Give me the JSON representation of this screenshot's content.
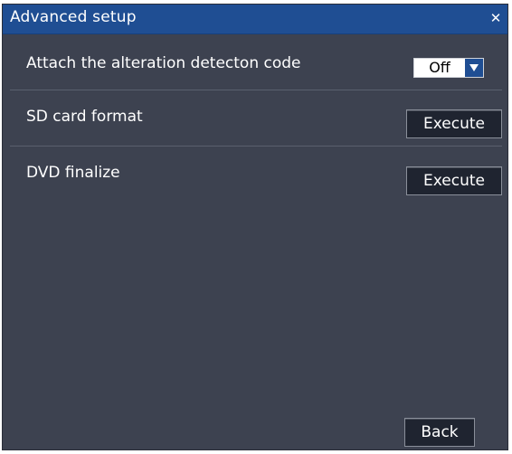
{
  "dialog": {
    "title": "Advanced setup",
    "close_icon": "close-icon"
  },
  "settings": [
    {
      "label": "Attach the alteration detecton code",
      "control": "select",
      "value": "Off"
    },
    {
      "label": "SD card format",
      "control": "button",
      "button_label": "Execute"
    },
    {
      "label": "DVD finalize",
      "control": "button",
      "button_label": "Execute"
    }
  ],
  "footer": {
    "back_label": "Back"
  },
  "colors": {
    "titlebar": "#1f4e93",
    "panel": "#3d4250",
    "button": "#1f2430",
    "separator": "#5a606e"
  }
}
